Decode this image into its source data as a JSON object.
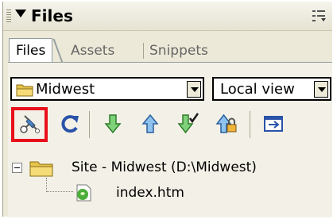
{
  "panel": {
    "title": "Files"
  },
  "tabs": [
    {
      "label": "Files",
      "active": true
    },
    {
      "label": "Assets",
      "active": false
    },
    {
      "label": "Snippets",
      "active": false
    }
  ],
  "site_select": {
    "value": "Midwest"
  },
  "view_select": {
    "value": "Local view"
  },
  "toolbar": {
    "icons": [
      "connect-icon",
      "refresh-icon",
      "get-icon",
      "put-icon",
      "check-out-icon",
      "check-in-icon",
      "expand-icon"
    ],
    "highlight_color": "#e8101a"
  },
  "tree": {
    "root_label": "Site - Midwest (D:\\Midwest)",
    "files": [
      {
        "label": "index.htm"
      }
    ]
  },
  "colors": {
    "panel_bg": "#ece9d8",
    "arrow_green": "#2ea63a",
    "arrow_blue": "#3d7fd6",
    "folder_yellow": "#e6c34a"
  }
}
